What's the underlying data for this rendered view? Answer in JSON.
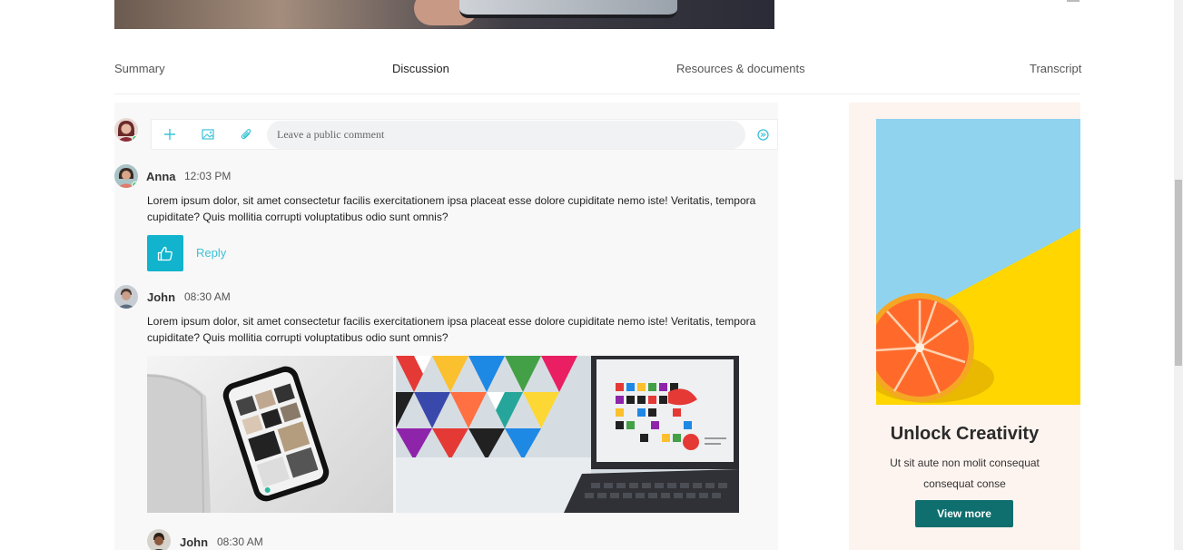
{
  "tabs": [
    "Summary",
    "Discussion",
    "Resources & documents",
    "Transcript"
  ],
  "active_tab": "Discussion",
  "composer": {
    "placeholder": "Leave a public comment",
    "add_icon": "plus-icon",
    "image_icon": "image-icon",
    "attach_icon": "paperclip-icon",
    "send_icon": "send-icon"
  },
  "comments": [
    {
      "author": "Anna",
      "time": "12:03 PM",
      "text": "Lorem ipsum dolor, sit amet consectetur facilis exercitationem ipsa placeat esse dolore cupiditate nemo iste! Veritatis, tempora cupiditate? Quis mollitia corrupti voluptatibus odio sunt omnis?",
      "like_icon": "thumbs-up-icon",
      "reply_label": "Reply"
    },
    {
      "author": "John",
      "time": "08:30 AM",
      "text": "Lorem ipsum dolor, sit amet consectetur facilis exercitationem ipsa placeat esse dolore cupiditate nemo iste! Veritatis, tempora cupiditate? Quis mollitia corrupti voluptatibus odio sunt omnis?"
    },
    {
      "author": "John",
      "time": "08:30 AM"
    }
  ],
  "ad": {
    "title": "Unlock Creativity",
    "text": "Ut sit aute non molit consequat consequat conse",
    "button_label": "View more"
  },
  "colors": {
    "accent": "#11b3cd",
    "accent_text": "#3cc3d6",
    "cta": "#0f6e6e",
    "ad_background": "#fdf4ef",
    "discussion_background": "#f8f8f8",
    "online": "#3cc86a"
  }
}
